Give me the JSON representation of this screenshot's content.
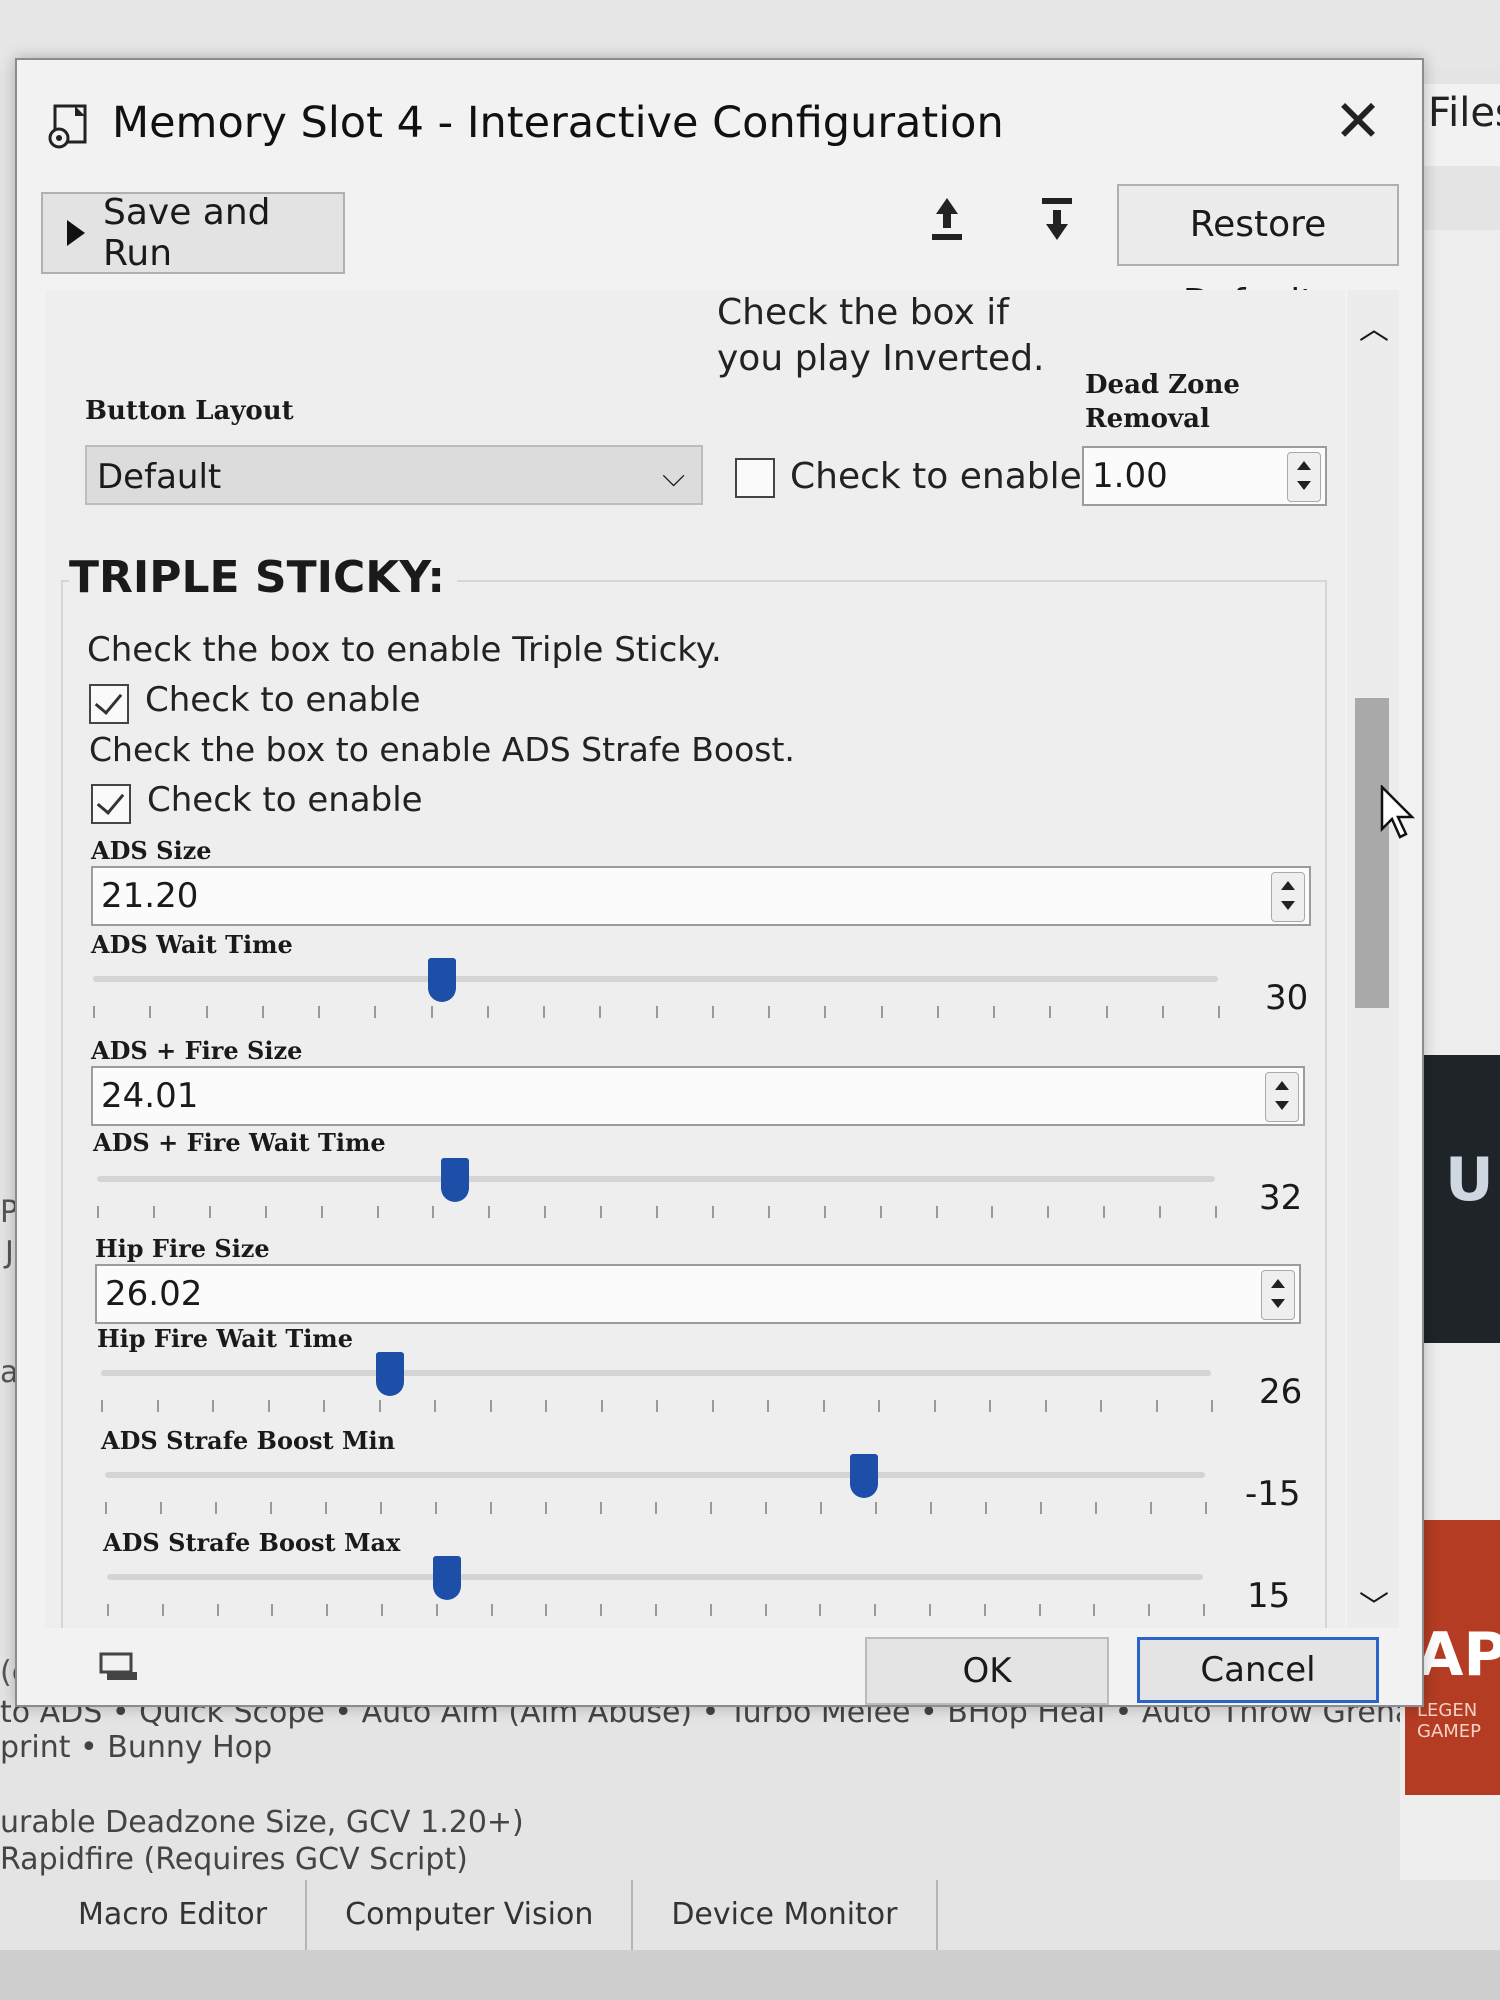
{
  "background": {
    "right_tab_label": "Files",
    "left_fragments": [
      "Pr",
      "Ju",
      "ab",
      "(co"
    ],
    "bottom_lines": [
      "to ADS • Quick Scope • Auto Aim (Aim Abuse) • Turbo Melee • BHop Heal • Auto Throw Grenade •",
      "print • Bunny Hop",
      "urable Deadzone Size, GCV 1.20+)",
      "Rapidfire (Requires GCV Script)"
    ],
    "tabs": [
      "Macro Editor",
      "Computer Vision",
      "Device Monitor"
    ],
    "thumb_dark_text": "U",
    "thumb_apex_text": "APE",
    "thumb_apex_sub": "LEGEN GAMEP"
  },
  "dialog": {
    "title": "Memory Slot 4 - Interactive Configuration",
    "toolbar": {
      "save_run_label": "Save and Run",
      "restore_label": "Restore Defaults"
    },
    "button_layout": {
      "label": "Button Layout",
      "value": "Default"
    },
    "inverted": {
      "prompt": "Check the box if you play Inverted.",
      "checkbox_label": "Check to enable",
      "checked": false
    },
    "dead_zone": {
      "label": "Dead Zone Removal",
      "value": "1.00"
    },
    "triple_sticky": {
      "title": "TRIPLE STICKY:",
      "enable_prompt": "Check the box to enable Triple Sticky.",
      "enable_label": "Check to enable",
      "enable_checked": true,
      "strafe_prompt": "Check the box to enable ADS Strafe Boost.",
      "strafe_label": "Check to enable",
      "strafe_checked": true,
      "ads_size_label": "ADS Size",
      "ads_size_value": "21.20",
      "ads_wait_label": "ADS Wait Time",
      "ads_wait_value": "30",
      "ads_fire_size_label": "ADS + Fire Size",
      "ads_fire_size_value": "24.01",
      "ads_fire_wait_label": "ADS + Fire Wait Time",
      "ads_fire_wait_value": "32",
      "hip_size_label": "Hip Fire Size",
      "hip_size_value": "26.02",
      "hip_wait_label": "Hip Fire Wait Time",
      "hip_wait_value": "26",
      "strafe_min_label": "ADS Strafe Boost Min",
      "strafe_min_value": "-15",
      "strafe_max_label": "ADS Strafe Boost Max",
      "strafe_max_value": "15"
    },
    "slider_levels": {
      "ads_wait": 0.31,
      "ads_fire_wait": 0.32,
      "hip_wait": 0.26,
      "strafe_min": 0.69,
      "strafe_max": 0.31
    },
    "footer": {
      "ok_label": "OK",
      "cancel_label": "Cancel"
    }
  },
  "colors": {
    "slider_thumb": "#1e4fa8",
    "cancel_border": "#2a64c8"
  }
}
